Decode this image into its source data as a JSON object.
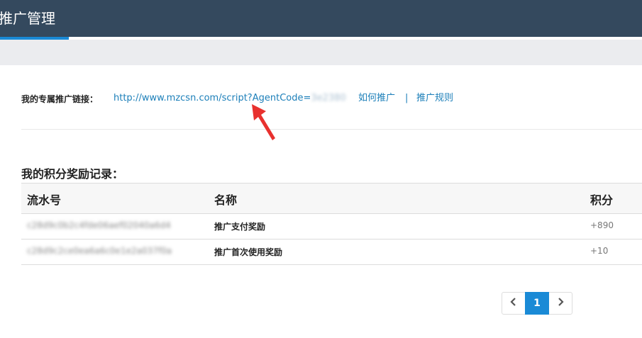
{
  "header": {
    "title": "推广管理"
  },
  "promo": {
    "label": "我的专属推广链接：",
    "link": "http://www.mzcsn.com/script?AgentCode=",
    "link_suffix_blurred": "3e2380",
    "how_to": "如何推广",
    "separator": "|",
    "rules": "推广规则"
  },
  "records": {
    "title": "我的积分奖励记录：",
    "columns": [
      "流水号",
      "名称",
      "积分"
    ],
    "rows": [
      {
        "serial": "c28d9c0b2c4fde06aef02040a6d4",
        "name": "推广支付奖励",
        "points": "+890"
      },
      {
        "serial": "c28d9c2ce0ea6a6c0e1e2a037f0a",
        "name": "推广首次使用奖励",
        "points": "+10"
      }
    ]
  },
  "pagination": {
    "prev": "‹",
    "current": "1",
    "next": "›"
  },
  "colors": {
    "header_bg": "#34495e",
    "accent": "#1a8ad6",
    "link": "#1c7fb9",
    "annotation_arrow": "#e8312e"
  }
}
